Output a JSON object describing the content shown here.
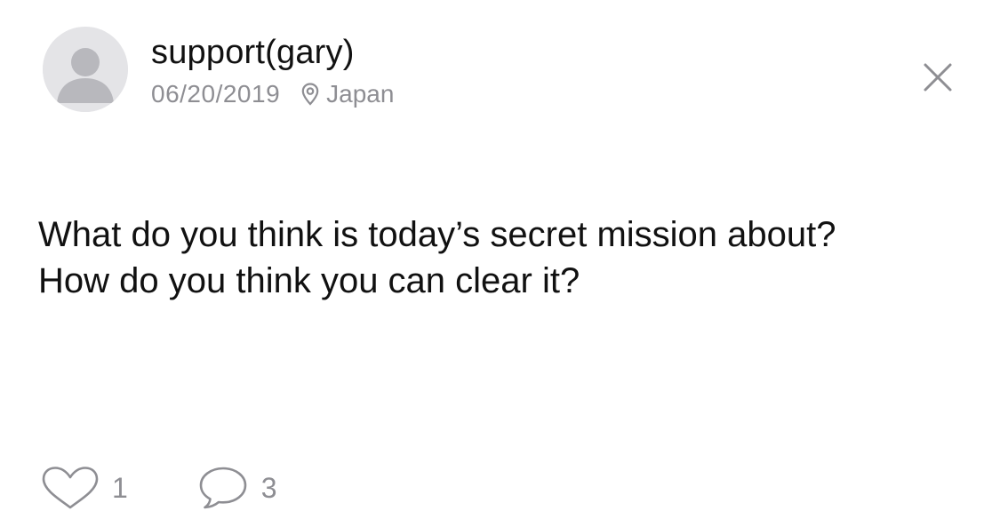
{
  "post": {
    "author": "support(gary)",
    "date": "06/20/2019",
    "location": "Japan",
    "body_lines": [
      "What do you think is today’s secret mission about?",
      "How do you think you can clear it?"
    ]
  },
  "actions": {
    "likes": "1",
    "comments": "3"
  },
  "icons": {
    "avatar": "default-user-avatar",
    "location": "map-pin-icon",
    "close": "close-icon",
    "like": "heart-outline-icon",
    "comment": "speech-bubble-icon"
  },
  "colors": {
    "text": "#111111",
    "muted": "#8e8e93",
    "avatar_bg": "#e4e4e7",
    "avatar_fg": "#b8b8bd"
  }
}
